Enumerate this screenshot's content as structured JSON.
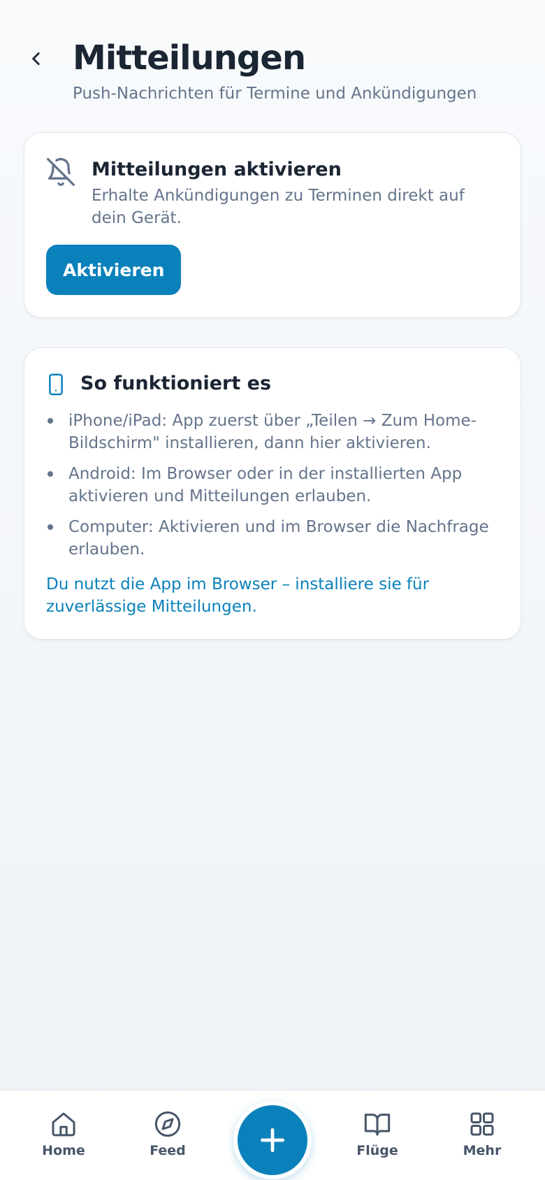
{
  "header": {
    "title": "Mitteilungen",
    "subtitle": "Push-Nachrichten für Termine und Ankündigungen",
    "back_icon": "chevron-left-icon"
  },
  "activate_card": {
    "icon": "bell-off-icon",
    "title": "Mitteilungen aktivieren",
    "description": "Erhalte Ankündigungen zu Terminen direkt auf dein Gerät.",
    "button_label": "Aktivieren"
  },
  "howto_card": {
    "icon": "smartphone-icon",
    "title": "So funktioniert es",
    "items": [
      "iPhone/iPad: App zuerst über „Teilen → Zum Home-Bildschirm\" installieren, dann hier aktivieren.",
      "Android: Im Browser oder in der installierten App aktivieren und Mitteilungen erlauben.",
      "Computer: Aktivieren und im Browser die Nachfrage erlauben."
    ],
    "note": "Du nutzt die App im Browser – installiere sie für zuverlässige Mitteilungen."
  },
  "bottom_nav": {
    "items": [
      {
        "label": "Home",
        "icon": "home-icon"
      },
      {
        "label": "Feed",
        "icon": "compass-icon"
      },
      {
        "label": "Flüge",
        "icon": "book-open-icon"
      },
      {
        "label": "Mehr",
        "icon": "grid-icon"
      }
    ],
    "fab_icon": "plus-icon"
  },
  "colors": {
    "accent": "#0b81bb",
    "text_primary": "#1b2533",
    "text_secondary": "#64748b",
    "background": "#f4f6f9"
  }
}
